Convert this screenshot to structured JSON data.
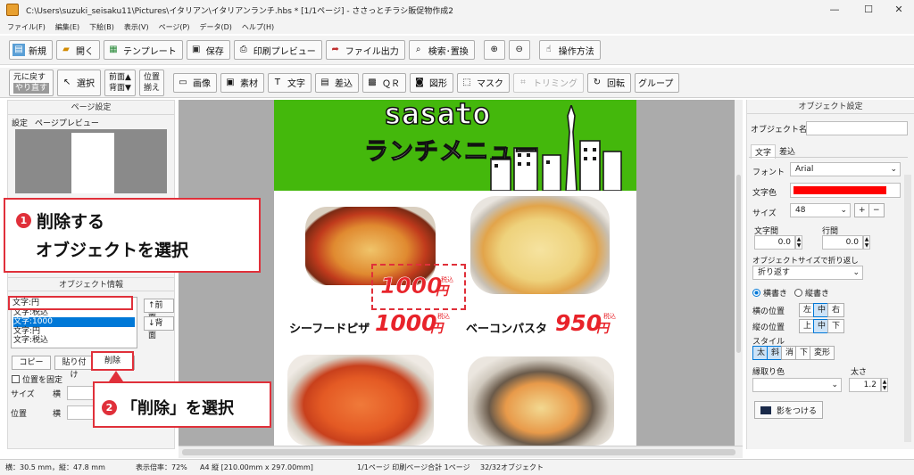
{
  "window": {
    "title": "C:\\Users\\suzuki_seisaku11\\Pictures\\イタリアン\\イタリアンランチ.hbs * [1/1ページ] - ささっとチラシ販促物作成2",
    "minimize": "—",
    "maximize": "☐",
    "close": "✕"
  },
  "menu": [
    "ファイル(F)",
    "編集(E)",
    "下絵(B)",
    "表示(V)",
    "ページ(P)",
    "データ(D)",
    "ヘルプ(H)"
  ],
  "toolbar1": {
    "new": "新規",
    "open": "開く",
    "template": "テンプレート",
    "save": "保存",
    "print_preview": "印刷プレビュー",
    "file_output": "ファイル出力",
    "search_replace": "検索･置換",
    "help": "操作方法"
  },
  "toolbar2": {
    "undo": "元に戻す",
    "redo": "やり直す",
    "select": "選択",
    "front": "前面▲",
    "back": "背面▼",
    "position": "位置",
    "align": "揃え",
    "image": "画像",
    "material": "素材",
    "text": "文字",
    "insert": "差込",
    "qr": "ＱＲ",
    "shape": "図形",
    "mask": "マスク",
    "trimming": "トリミング",
    "rotate": "回転",
    "group": "グループ"
  },
  "left_panel": {
    "page_settings_title": "ページ設定",
    "tab_settings": "設定",
    "tab_preview": "ページプレビュー",
    "object_info_title": "オブジェクト情報",
    "object_list": [
      "文字:円",
      "文字:税込",
      "文字:1000",
      "文字:円",
      "文字:税込"
    ],
    "selected_index": 2,
    "btn_front": "↑前面",
    "btn_back": "↓背面",
    "btn_copy": "コピー",
    "btn_paste": "貼り付け",
    "btn_delete": "削除",
    "fix_position": "位置を固定",
    "size_label": "サイズ",
    "width_label": "横",
    "position_label": "位置",
    "pos_x_label": "横"
  },
  "flyer": {
    "brand": "sasato",
    "headline": "ランチメニュー",
    "price_main": "1000",
    "price_unit": "円",
    "tax": "税込",
    "item1": "シーフードピザ",
    "item1_price": "1000",
    "item1_unit": "円",
    "item2": "ベーコンパスタ",
    "item2_price": "950",
    "item2_unit": "円"
  },
  "right_panel": {
    "title": "オブジェクト設定",
    "object_name_label": "オブジェクト名",
    "tab_text": "文字",
    "tab_insert": "差込",
    "font_label": "フォント",
    "font_value": "Arial",
    "color_label": "文字色",
    "color_value": "#ff0000",
    "size_label": "サイズ",
    "size_value": "48",
    "char_spacing_label": "文字間",
    "char_spacing_value": "0.0",
    "line_spacing_label": "行間",
    "line_spacing_value": "0.0",
    "wrap_label": "オブジェクトサイズで折り返し",
    "wrap_value": "折り返す",
    "horizontal": "横書き",
    "vertical": "縦書き",
    "h_align_label": "横の位置",
    "h_left": "左",
    "h_center": "中",
    "h_right": "右",
    "v_align_label": "縦の位置",
    "v_top": "上",
    "v_middle": "中",
    "v_bottom": "下",
    "style_label": "スタイル",
    "bold": "太",
    "italic": "斜",
    "strike": "消",
    "underline": "下",
    "transform": "変形",
    "outline_label": "縁取り色",
    "thickness_label": "太さ",
    "thickness_value": "1.2",
    "shadow_button": "影をつける"
  },
  "status": {
    "size": "横：30.5 mm，縦：47.8 mm",
    "zoom": "表示倍率：72%",
    "paper": "A4 縦 [210.00mm x 297.00mm]",
    "pages": "1/1ページ 印刷ページ合計 1ページ",
    "objects": "32/32オブジェクト"
  },
  "callouts": {
    "step1_num": "1",
    "step1_line1": "削除する",
    "step1_line2": "オブジェクトを選択",
    "step2_num": "2",
    "step2_text": "「削除」を選択"
  },
  "colors": {
    "accent_red": "#e0303a",
    "flyer_green": "#44b80c",
    "price_red": "#e8232a",
    "selection_blue": "#0078d7"
  }
}
